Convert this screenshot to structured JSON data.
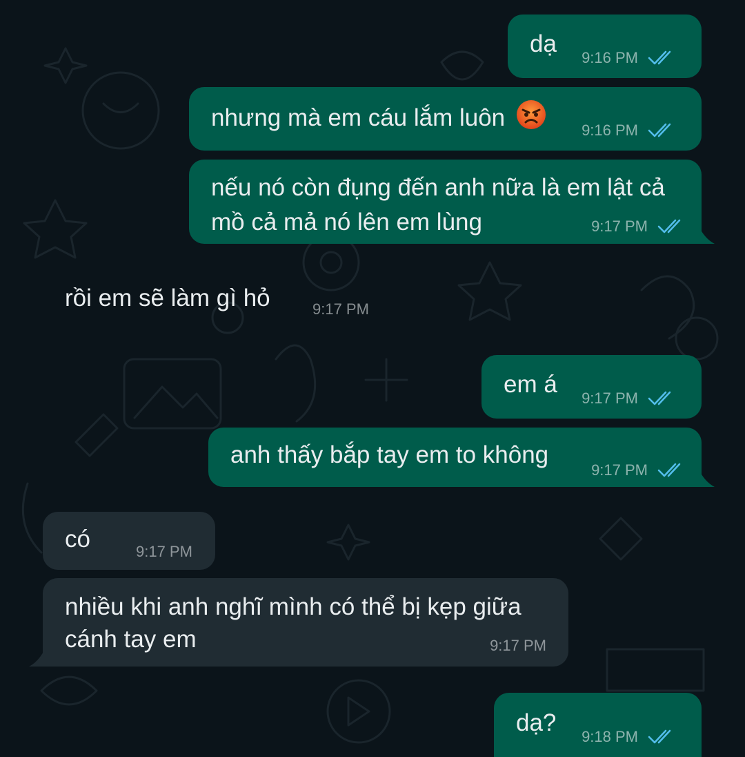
{
  "messages": [
    {
      "id": "m1",
      "direction": "outgoing",
      "lines": [
        "dạ"
      ],
      "time": "9:16 PM",
      "status": "read"
    },
    {
      "id": "m2",
      "direction": "outgoing",
      "lines": [
        "nhưng mà em cáu lắm luôn"
      ],
      "emoji": "angry-face",
      "time": "9:16 PM",
      "status": "read"
    },
    {
      "id": "m3",
      "direction": "outgoing",
      "lines": [
        "nếu nó còn đụng đến anh nữa là em lật cả",
        "mồ cả mả nó lên em lùng"
      ],
      "time": "9:17 PM",
      "status": "read"
    },
    {
      "id": "m4",
      "direction": "incoming",
      "lines": [
        "rồi em sẽ làm gì hỏ"
      ],
      "time": "9:17 PM"
    },
    {
      "id": "m5",
      "direction": "outgoing",
      "lines": [
        "em á"
      ],
      "time": "9:17 PM",
      "status": "read"
    },
    {
      "id": "m6",
      "direction": "outgoing",
      "lines": [
        "anh thấy bắp tay em to không"
      ],
      "time": "9:17 PM",
      "status": "read"
    },
    {
      "id": "m7",
      "direction": "incoming",
      "lines": [
        "có"
      ],
      "time": "9:17 PM"
    },
    {
      "id": "m8",
      "direction": "incoming",
      "lines": [
        "nhiều khi anh nghĩ mình có thể bị kẹp giữa",
        "cánh tay em"
      ],
      "time": "9:17 PM"
    },
    {
      "id": "m9",
      "direction": "outgoing",
      "lines": [
        "dạ?"
      ],
      "time": "9:18 PM",
      "status": "read"
    }
  ],
  "colors": {
    "background": "#0b141a",
    "outgoing_bubble": "#005c4b",
    "incoming_bubble": "#202c33",
    "read_tick": "#53bdeb",
    "text": "#e9edef"
  },
  "icons": {
    "read_status": "double-check-icon",
    "emoji": "angry-face-emoji"
  }
}
